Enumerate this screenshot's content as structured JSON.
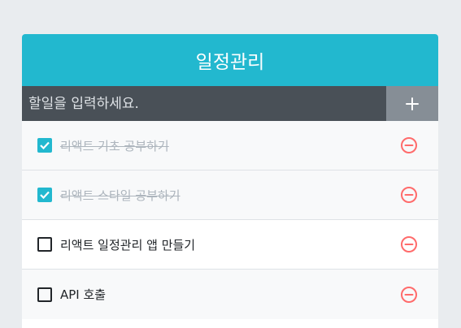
{
  "header": {
    "title": "일정관리"
  },
  "insert": {
    "placeholder": "할일을 입력하세요.",
    "button_icon": "plus-icon"
  },
  "todos": [
    {
      "text": "리액트 기초 공부하기",
      "checked": true
    },
    {
      "text": "리액트 스타일 공부하기",
      "checked": true
    },
    {
      "text": "리액트 일정관리 앱 만들기",
      "checked": false
    },
    {
      "text": "API 호출",
      "checked": false
    }
  ],
  "colors": {
    "accent": "#22b8cf",
    "insert_bg": "#495057",
    "insert_button_bg": "#868e96",
    "remove": "#ff6b6b",
    "page_bg": "#e9ecef",
    "done_text": "#adb5bd"
  }
}
